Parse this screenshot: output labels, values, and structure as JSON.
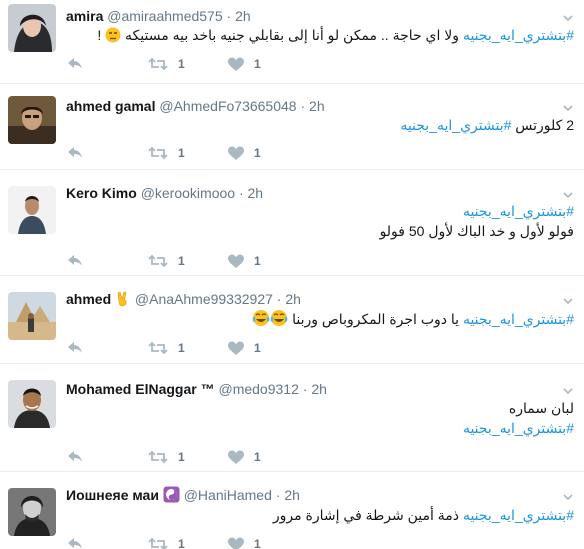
{
  "colors": {
    "hashtag": "#1b95e0",
    "icon": "#aab8c2",
    "meta": "#657786",
    "divider": "#e6ecf0"
  },
  "icons": {
    "reply": "reply-icon",
    "retweet": "retweet-icon",
    "like": "heart-icon",
    "more": "chevron-down-icon"
  },
  "tweets": [
    {
      "name": "amira",
      "handle": "@amiraahmed575",
      "dot": "·",
      "time": "2h",
      "hashtag": "#بتشتري_ايه_بجنيه",
      "text": "ولا اي حاجة .. ممكن لو أنا إلى بقابلي جنيه باخد بيه مستيكه",
      "suffix": "!",
      "emoji": "unamused-face",
      "retweets": "1",
      "likes": "1"
    },
    {
      "name": "ahmed gamal",
      "handle": "@AhmedFo73665048",
      "dot": "·",
      "time": "2h",
      "prefix": "2 كلورتس",
      "hashtag": "#بتشتري_ايه_بجنيه",
      "retweets": "1",
      "likes": "1"
    },
    {
      "name": "Kero Kimo",
      "handle": "@kerookimooo",
      "dot": "·",
      "time": "2h",
      "hashtag": "#بتشتري_ايه_بجنيه",
      "text": "فولو لأول و خد الباك لأول 50 فولو",
      "retweets": "1",
      "likes": "1"
    },
    {
      "name": "ahmed",
      "handle": "@AnaAhme99332927",
      "dot": "·",
      "time": "2h",
      "name_emoji": "victory-hand",
      "hashtag": "#بتشتري_ايه_بجنيه",
      "text": "يا دوب اجرة المكروباص وربنا",
      "emoji": "tears-of-joy-x2",
      "retweets": "1",
      "likes": "1"
    },
    {
      "name": "Mohamed ElNaggar ™",
      "handle": "@medo9312",
      "dot": "·",
      "time": "2h",
      "text": "لبان سماره",
      "hashtag": "#بتشتري_ايه_بجنيه",
      "retweets": "1",
      "likes": "1"
    },
    {
      "name": "Иошнеяе маи",
      "handle": "@HaniHamed",
      "dot": "·",
      "time": "2h",
      "name_emoji": "yin-yang-purple",
      "hashtag": "#بتشتري_ايه_بجنيه",
      "text": "ذمة أمين شرطة في إشارة مرور",
      "retweets": "1",
      "likes": "1"
    }
  ]
}
